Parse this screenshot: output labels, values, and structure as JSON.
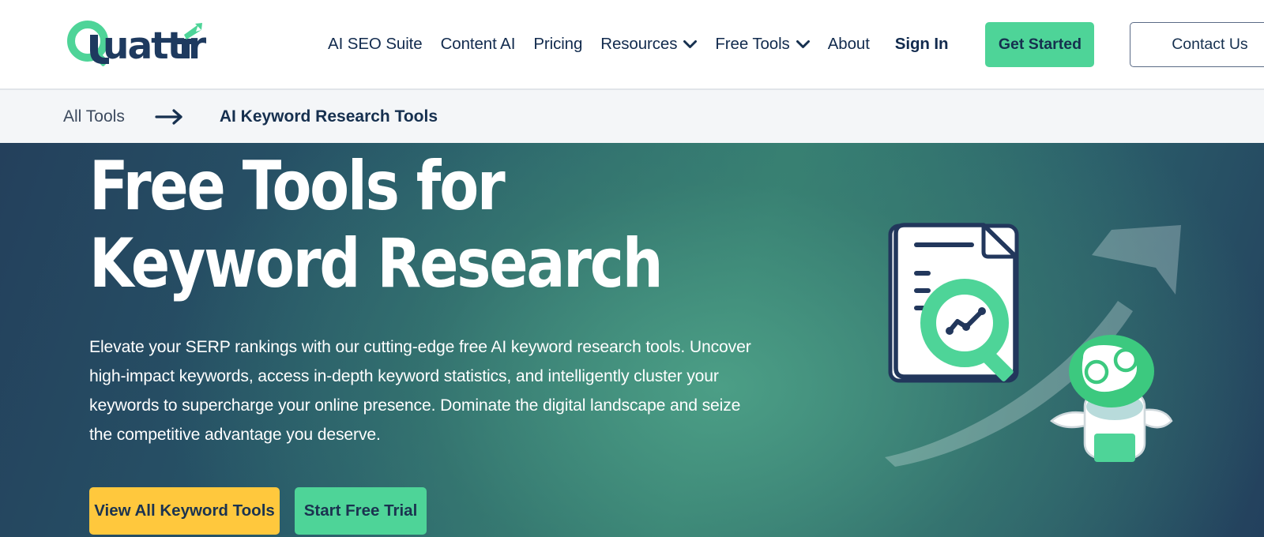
{
  "site": {
    "brand_name": "Quattr",
    "logo_icon": "magnifier-logo-icon",
    "accent_green": "#4ed498",
    "accent_navy": "#16304f",
    "accent_yellow": "#ffc83d"
  },
  "header": {
    "nav_items": [
      {
        "label": "AI SEO Suite",
        "has_caret": false
      },
      {
        "label": "Content AI",
        "has_caret": false
      },
      {
        "label": "Pricing",
        "has_caret": false
      },
      {
        "label": "Resources",
        "has_caret": true
      },
      {
        "label": "Free Tools",
        "has_caret": true
      },
      {
        "label": "About",
        "has_caret": false
      }
    ],
    "sign_in_label": "Sign In",
    "get_started_label": "Get Started",
    "contact_us_label": "Contact Us"
  },
  "breadcrumb": {
    "parent_label": "All Tools",
    "separator_icon": "arrow-right-icon",
    "current_label": "AI Keyword Research Tools"
  },
  "hero": {
    "title_line_1": "Free Tools for",
    "title_line_2": "Keyword Research",
    "paragraph": "Elevate your SERP rankings with our cutting-edge free AI keyword research tools. Uncover high-impact keywords, access in-depth keyword statistics, and intelligently cluster your keywords to supercharge your online presence. Dominate the digital landscape and seize the competitive advantage you deserve.",
    "cta_primary_label": "View All Keyword Tools",
    "cta_secondary_label": "Start Free Trial",
    "illustration_icons": [
      "document-icon",
      "magnifier-chart-icon",
      "growth-arrow-icon",
      "robot-mascot-icon"
    ]
  }
}
